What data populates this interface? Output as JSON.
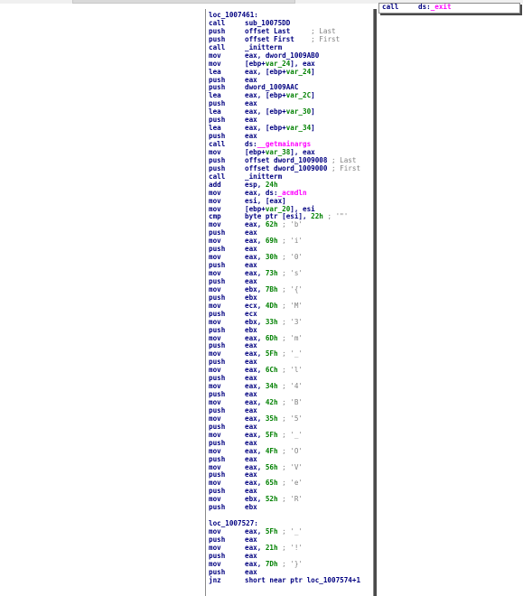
{
  "right_block": {
    "lines": [
      {
        "mn": "call",
        "parts": [
          {
            "t": "ds:",
            "c": "plain"
          },
          {
            "t": "_exit",
            "c": "pink"
          }
        ]
      }
    ]
  },
  "main_block": {
    "lines": [
      {
        "label": "loc_1007461:"
      },
      {
        "mn": "call",
        "parts": [
          {
            "t": "sub_10075DD",
            "c": "plain"
          }
        ]
      },
      {
        "mn": "push",
        "parts": [
          {
            "t": "offset Last     ",
            "c": "plain"
          },
          {
            "t": "; Last",
            "c": "cmt"
          }
        ]
      },
      {
        "mn": "push",
        "parts": [
          {
            "t": "offset First    ",
            "c": "plain"
          },
          {
            "t": "; First",
            "c": "cmt"
          }
        ]
      },
      {
        "mn": "call",
        "parts": [
          {
            "t": "_initterm",
            "c": "plain"
          }
        ]
      },
      {
        "mn": "mov",
        "parts": [
          {
            "t": "eax, dword_1009AB0",
            "c": "plain"
          }
        ]
      },
      {
        "mn": "mov",
        "parts": [
          {
            "t": "[ebp+",
            "c": "plain"
          },
          {
            "t": "var_24",
            "c": "num"
          },
          {
            "t": "], eax",
            "c": "plain"
          }
        ]
      },
      {
        "mn": "lea",
        "parts": [
          {
            "t": "eax, [ebp+",
            "c": "plain"
          },
          {
            "t": "var_24",
            "c": "num"
          },
          {
            "t": "]",
            "c": "plain"
          }
        ]
      },
      {
        "mn": "push",
        "parts": [
          {
            "t": "eax",
            "c": "plain"
          }
        ]
      },
      {
        "mn": "push",
        "parts": [
          {
            "t": "dword_1009AAC",
            "c": "plain"
          }
        ]
      },
      {
        "mn": "lea",
        "parts": [
          {
            "t": "eax, [ebp+",
            "c": "plain"
          },
          {
            "t": "var_2C",
            "c": "num"
          },
          {
            "t": "]",
            "c": "plain"
          }
        ]
      },
      {
        "mn": "push",
        "parts": [
          {
            "t": "eax",
            "c": "plain"
          }
        ]
      },
      {
        "mn": "lea",
        "parts": [
          {
            "t": "eax, [ebp+",
            "c": "plain"
          },
          {
            "t": "var_30",
            "c": "num"
          },
          {
            "t": "]",
            "c": "plain"
          }
        ]
      },
      {
        "mn": "push",
        "parts": [
          {
            "t": "eax",
            "c": "plain"
          }
        ]
      },
      {
        "mn": "lea",
        "parts": [
          {
            "t": "eax, [ebp+",
            "c": "plain"
          },
          {
            "t": "var_34",
            "c": "num"
          },
          {
            "t": "]",
            "c": "plain"
          }
        ]
      },
      {
        "mn": "push",
        "parts": [
          {
            "t": "eax",
            "c": "plain"
          }
        ]
      },
      {
        "mn": "call",
        "parts": [
          {
            "t": "ds:",
            "c": "plain"
          },
          {
            "t": "__getmainargs",
            "c": "pink"
          }
        ]
      },
      {
        "mn": "mov",
        "parts": [
          {
            "t": "[ebp+",
            "c": "plain"
          },
          {
            "t": "var_38",
            "c": "num"
          },
          {
            "t": "], eax",
            "c": "plain"
          }
        ]
      },
      {
        "mn": "push",
        "parts": [
          {
            "t": "offset dword_1009008 ",
            "c": "plain"
          },
          {
            "t": "; Last",
            "c": "cmt"
          }
        ]
      },
      {
        "mn": "push",
        "parts": [
          {
            "t": "offset dword_1009000 ",
            "c": "plain"
          },
          {
            "t": "; First",
            "c": "cmt"
          }
        ]
      },
      {
        "mn": "call",
        "parts": [
          {
            "t": "_initterm",
            "c": "plain"
          }
        ]
      },
      {
        "mn": "add",
        "parts": [
          {
            "t": "esp, ",
            "c": "plain"
          },
          {
            "t": "24h",
            "c": "num"
          }
        ]
      },
      {
        "mn": "mov",
        "parts": [
          {
            "t": "eax, ds:",
            "c": "plain"
          },
          {
            "t": "_acmdln",
            "c": "pink"
          }
        ]
      },
      {
        "mn": "mov",
        "parts": [
          {
            "t": "esi, [eax]",
            "c": "plain"
          }
        ]
      },
      {
        "mn": "mov",
        "parts": [
          {
            "t": "[ebp+",
            "c": "plain"
          },
          {
            "t": "var_20",
            "c": "num"
          },
          {
            "t": "], esi",
            "c": "plain"
          }
        ]
      },
      {
        "mn": "cmp",
        "parts": [
          {
            "t": "byte ptr [esi], ",
            "c": "plain"
          },
          {
            "t": "22h",
            "c": "num"
          },
          {
            "t": " ; '\"'",
            "c": "cmt"
          }
        ]
      },
      {
        "mn": "mov",
        "parts": [
          {
            "t": "eax, ",
            "c": "plain"
          },
          {
            "t": "62h",
            "c": "num"
          },
          {
            "t": " ; 'b'",
            "c": "cmt"
          }
        ]
      },
      {
        "mn": "push",
        "parts": [
          {
            "t": "eax",
            "c": "plain"
          }
        ]
      },
      {
        "mn": "mov",
        "parts": [
          {
            "t": "eax, ",
            "c": "plain"
          },
          {
            "t": "69h",
            "c": "num"
          },
          {
            "t": " ; 'i'",
            "c": "cmt"
          }
        ]
      },
      {
        "mn": "push",
        "parts": [
          {
            "t": "eax",
            "c": "plain"
          }
        ]
      },
      {
        "mn": "mov",
        "parts": [
          {
            "t": "eax, ",
            "c": "plain"
          },
          {
            "t": "30h",
            "c": "num"
          },
          {
            "t": " ; '0'",
            "c": "cmt"
          }
        ]
      },
      {
        "mn": "push",
        "parts": [
          {
            "t": "eax",
            "c": "plain"
          }
        ]
      },
      {
        "mn": "mov",
        "parts": [
          {
            "t": "eax, ",
            "c": "plain"
          },
          {
            "t": "73h",
            "c": "num"
          },
          {
            "t": " ; 's'",
            "c": "cmt"
          }
        ]
      },
      {
        "mn": "push",
        "parts": [
          {
            "t": "eax",
            "c": "plain"
          }
        ]
      },
      {
        "mn": "mov",
        "parts": [
          {
            "t": "ebx, ",
            "c": "plain"
          },
          {
            "t": "7Bh",
            "c": "num"
          },
          {
            "t": " ; '{'",
            "c": "cmt"
          }
        ]
      },
      {
        "mn": "push",
        "parts": [
          {
            "t": "ebx",
            "c": "plain"
          }
        ]
      },
      {
        "mn": "mov",
        "parts": [
          {
            "t": "ecx, ",
            "c": "plain"
          },
          {
            "t": "4Dh",
            "c": "num"
          },
          {
            "t": " ; 'M'",
            "c": "cmt"
          }
        ]
      },
      {
        "mn": "push",
        "parts": [
          {
            "t": "ecx",
            "c": "plain"
          }
        ]
      },
      {
        "mn": "mov",
        "parts": [
          {
            "t": "ebx, ",
            "c": "plain"
          },
          {
            "t": "33h",
            "c": "num"
          },
          {
            "t": " ; '3'",
            "c": "cmt"
          }
        ]
      },
      {
        "mn": "push",
        "parts": [
          {
            "t": "ebx",
            "c": "plain"
          }
        ]
      },
      {
        "mn": "mov",
        "parts": [
          {
            "t": "eax, ",
            "c": "plain"
          },
          {
            "t": "6Dh",
            "c": "num"
          },
          {
            "t": " ; 'm'",
            "c": "cmt"
          }
        ]
      },
      {
        "mn": "push",
        "parts": [
          {
            "t": "eax",
            "c": "plain"
          }
        ]
      },
      {
        "mn": "mov",
        "parts": [
          {
            "t": "eax, ",
            "c": "plain"
          },
          {
            "t": "5Fh",
            "c": "num"
          },
          {
            "t": " ; '_'",
            "c": "cmt"
          }
        ]
      },
      {
        "mn": "push",
        "parts": [
          {
            "t": "eax",
            "c": "plain"
          }
        ]
      },
      {
        "mn": "mov",
        "parts": [
          {
            "t": "eax, ",
            "c": "plain"
          },
          {
            "t": "6Ch",
            "c": "num"
          },
          {
            "t": " ; 'l'",
            "c": "cmt"
          }
        ]
      },
      {
        "mn": "push",
        "parts": [
          {
            "t": "eax",
            "c": "plain"
          }
        ]
      },
      {
        "mn": "mov",
        "parts": [
          {
            "t": "eax, ",
            "c": "plain"
          },
          {
            "t": "34h",
            "c": "num"
          },
          {
            "t": " ; '4'",
            "c": "cmt"
          }
        ]
      },
      {
        "mn": "push",
        "parts": [
          {
            "t": "eax",
            "c": "plain"
          }
        ]
      },
      {
        "mn": "mov",
        "parts": [
          {
            "t": "eax, ",
            "c": "plain"
          },
          {
            "t": "42h",
            "c": "num"
          },
          {
            "t": " ; 'B'",
            "c": "cmt"
          }
        ]
      },
      {
        "mn": "push",
        "parts": [
          {
            "t": "eax",
            "c": "plain"
          }
        ]
      },
      {
        "mn": "mov",
        "parts": [
          {
            "t": "eax, ",
            "c": "plain"
          },
          {
            "t": "35h",
            "c": "num"
          },
          {
            "t": " ; '5'",
            "c": "cmt"
          }
        ]
      },
      {
        "mn": "push",
        "parts": [
          {
            "t": "eax",
            "c": "plain"
          }
        ]
      },
      {
        "mn": "mov",
        "parts": [
          {
            "t": "eax, ",
            "c": "plain"
          },
          {
            "t": "5Fh",
            "c": "num"
          },
          {
            "t": " ; '_'",
            "c": "cmt"
          }
        ]
      },
      {
        "mn": "push",
        "parts": [
          {
            "t": "eax",
            "c": "plain"
          }
        ]
      },
      {
        "mn": "mov",
        "parts": [
          {
            "t": "eax, ",
            "c": "plain"
          },
          {
            "t": "4Fh",
            "c": "num"
          },
          {
            "t": " ; 'O'",
            "c": "cmt"
          }
        ]
      },
      {
        "mn": "push",
        "parts": [
          {
            "t": "eax",
            "c": "plain"
          }
        ]
      },
      {
        "mn": "mov",
        "parts": [
          {
            "t": "eax, ",
            "c": "plain"
          },
          {
            "t": "56h",
            "c": "num"
          },
          {
            "t": " ; 'V'",
            "c": "cmt"
          }
        ]
      },
      {
        "mn": "push",
        "parts": [
          {
            "t": "eax",
            "c": "plain"
          }
        ]
      },
      {
        "mn": "mov",
        "parts": [
          {
            "t": "eax, ",
            "c": "plain"
          },
          {
            "t": "65h",
            "c": "num"
          },
          {
            "t": " ; 'e'",
            "c": "cmt"
          }
        ]
      },
      {
        "mn": "push",
        "parts": [
          {
            "t": "eax",
            "c": "plain"
          }
        ]
      },
      {
        "mn": "mov",
        "parts": [
          {
            "t": "ebx, ",
            "c": "plain"
          },
          {
            "t": "52h",
            "c": "num"
          },
          {
            "t": " ; 'R'",
            "c": "cmt"
          }
        ]
      },
      {
        "mn": "push",
        "parts": [
          {
            "t": "ebx",
            "c": "plain"
          }
        ]
      },
      {
        "blank": true
      },
      {
        "label": "loc_1007527:"
      },
      {
        "mn": "mov",
        "parts": [
          {
            "t": "eax, ",
            "c": "plain"
          },
          {
            "t": "5Fh",
            "c": "num"
          },
          {
            "t": " ; '_'",
            "c": "cmt"
          }
        ]
      },
      {
        "mn": "push",
        "parts": [
          {
            "t": "eax",
            "c": "plain"
          }
        ]
      },
      {
        "mn": "mov",
        "parts": [
          {
            "t": "eax, ",
            "c": "plain"
          },
          {
            "t": "21h",
            "c": "num"
          },
          {
            "t": " ; '!'",
            "c": "cmt"
          }
        ]
      },
      {
        "mn": "push",
        "parts": [
          {
            "t": "eax",
            "c": "plain"
          }
        ]
      },
      {
        "mn": "mov",
        "parts": [
          {
            "t": "eax, ",
            "c": "plain"
          },
          {
            "t": "7Dh",
            "c": "num"
          },
          {
            "t": " ; '}'",
            "c": "cmt"
          }
        ]
      },
      {
        "mn": "push",
        "parts": [
          {
            "t": "eax",
            "c": "plain"
          }
        ]
      },
      {
        "mn": "jnz",
        "parts": [
          {
            "t": "short near ptr loc_1007574+1",
            "c": "plain"
          }
        ]
      }
    ]
  }
}
